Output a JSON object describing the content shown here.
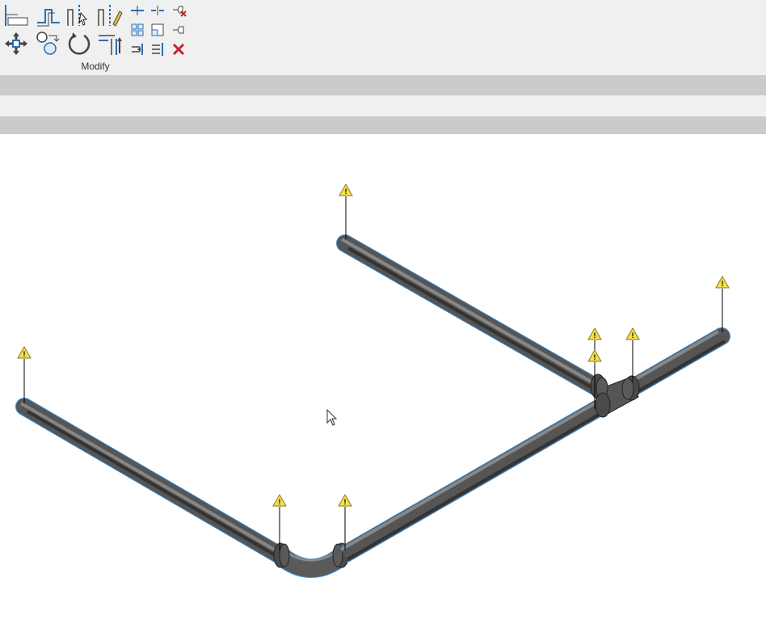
{
  "ribbon": {
    "modify_panel_label": "Modify",
    "tools": [
      {
        "icon": "align-icon"
      },
      {
        "icon": "offset-icon"
      },
      {
        "icon": "mirror-pick-axis-icon"
      },
      {
        "icon": "mirror-draw-axis-icon"
      },
      {
        "icon": "split-element-icon"
      },
      {
        "icon": "split-with-gap-icon"
      },
      {
        "icon": "unpin-icon"
      },
      {
        "icon": "move-icon"
      },
      {
        "icon": "copy-icon"
      },
      {
        "icon": "rotate-icon"
      },
      {
        "icon": "trim-extend-to-corner-icon"
      },
      {
        "icon": "array-icon"
      },
      {
        "icon": "scale-icon"
      },
      {
        "icon": "pin-icon"
      },
      {
        "icon": "trim-extend-single-icon"
      },
      {
        "icon": "trim-extend-multiple-icon"
      },
      {
        "icon": "delete-icon"
      }
    ]
  },
  "viewport": {
    "content": "3D pipe model with elbow, tee and warning markers",
    "warning_marker_icon": "warning-triangle-icon",
    "colors": {
      "pipe": "#5a5a5a",
      "pipe_edge": "#3a8fd8",
      "warning_fill": "#f5e04a"
    }
  }
}
